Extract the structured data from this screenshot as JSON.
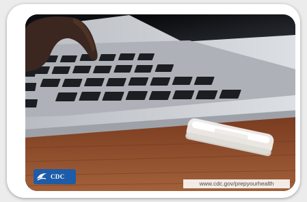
{
  "logo": {
    "text": "CDC",
    "color": "#1d5ca8"
  },
  "footer": {
    "url": "www.cdc.gov/prepyourhealth"
  },
  "colors": {
    "desk": "#8a4a2a",
    "laptop": "#c9ccd1",
    "background": "#0e0f12"
  }
}
